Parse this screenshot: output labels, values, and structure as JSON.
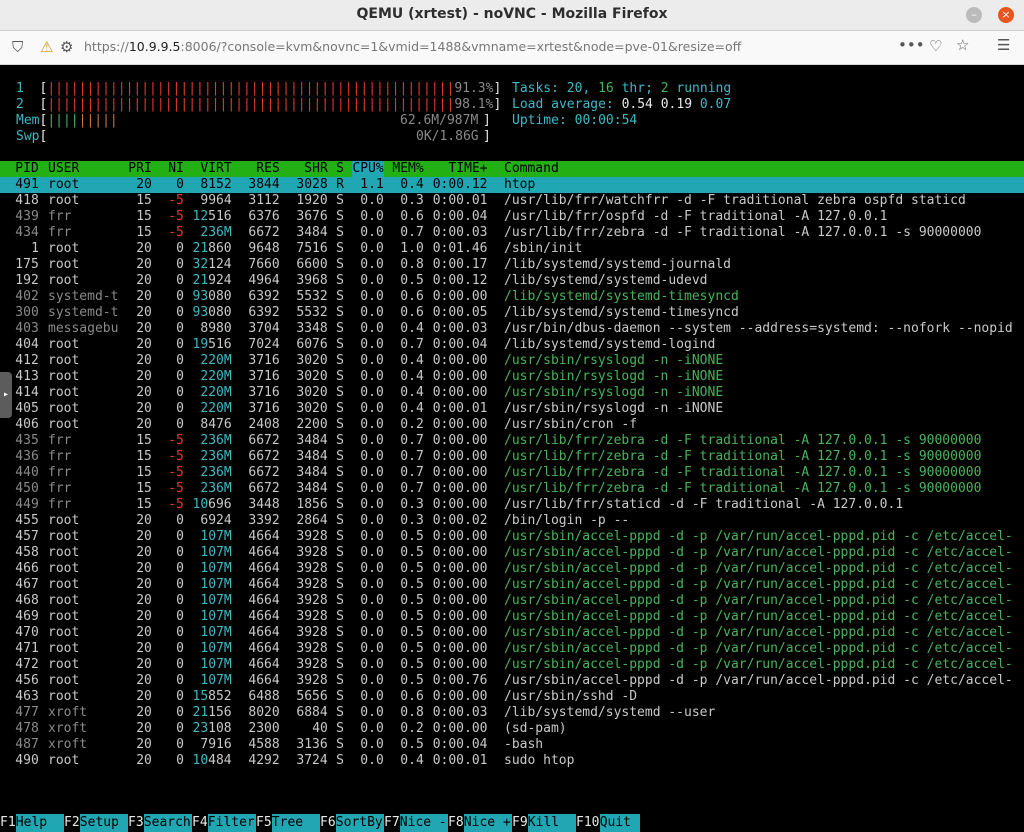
{
  "window": {
    "title": "QEMU (xrtest) - noVNC - Mozilla Firefox"
  },
  "browser": {
    "url_prefix": "https://",
    "url_host": "10.9.9.5",
    "url_rest": ":8006/?console=kvm&novnc=1&vmid=1488&vmname=xrtest&node=pve-01&resize=off"
  },
  "htop": {
    "cpu1": {
      "label": "1",
      "bar": "||||||||||||||||||||||||||||||||||||||||||||||||||||",
      "percent": "91.3%"
    },
    "cpu2": {
      "label": "2",
      "bar": "||||||||||||||||||||||||||||||||||||||||||||||||||||",
      "percent": "98.1%"
    },
    "mem": {
      "label": "Mem",
      "bar_green": "||||",
      "bar_orange": "|||||",
      "value": "62.6M/987M"
    },
    "swp": {
      "label": "Swp",
      "value": "0K/1.86G"
    },
    "tasks": {
      "label": "Tasks:",
      "tasks": "20,",
      "thr": "16",
      "thr_label": "thr;",
      "running": "2",
      "running_label": "running"
    },
    "load": {
      "label": "Load average:",
      "l1": "0.54",
      "l5": "0.19",
      "l15": "0.07"
    },
    "uptime": {
      "label": "Uptime:",
      "value": "00:00:54"
    },
    "columns": [
      "PID",
      "USER",
      "PRI",
      "NI",
      "VIRT",
      "RES",
      "SHR",
      "S",
      "CPU%",
      "MEM%",
      "TIME+",
      "Command"
    ],
    "processes": [
      {
        "pid": "491",
        "user": "root",
        "pri": "20",
        "ni": "0",
        "virt": "8152",
        "res": "3844",
        "shr": "3028",
        "s": "R",
        "cpu": "1.1",
        "mem": "0.4",
        "time": "0:00.12",
        "cmd": "htop",
        "sel": true
      },
      {
        "pid": "418",
        "user": "root",
        "pri": "15",
        "ni": "-5",
        "virt": "9964",
        "res": "3112",
        "shr": "1920",
        "s": "S",
        "cpu": "0.0",
        "mem": "0.3",
        "time": "0:00.01",
        "cmd": "/usr/lib/frr/watchfrr -d -F traditional zebra ospfd staticd"
      },
      {
        "pid": "439",
        "user": "frr",
        "pri": "15",
        "ni": "-5",
        "virt": "12516",
        "res": "6376",
        "shr": "3676",
        "s": "S",
        "cpu": "0.0",
        "mem": "0.6",
        "time": "0:00.04",
        "cmd": "/usr/lib/frr/ospfd -d -F traditional -A 127.0.0.1"
      },
      {
        "pid": "434",
        "user": "frr",
        "pri": "15",
        "ni": "-5",
        "virt": "236M",
        "res": "6672",
        "shr": "3484",
        "s": "S",
        "cpu": "0.0",
        "mem": "0.7",
        "time": "0:00.03",
        "cmd": "/usr/lib/frr/zebra -d -F traditional -A 127.0.0.1 -s 90000000"
      },
      {
        "pid": "1",
        "user": "root",
        "pri": "20",
        "ni": "0",
        "virt": "21860",
        "res": "9648",
        "shr": "7516",
        "s": "S",
        "cpu": "0.0",
        "mem": "1.0",
        "time": "0:01.46",
        "cmd": "/sbin/init"
      },
      {
        "pid": "175",
        "user": "root",
        "pri": "20",
        "ni": "0",
        "virt": "32124",
        "res": "7660",
        "shr": "6600",
        "s": "S",
        "cpu": "0.0",
        "mem": "0.8",
        "time": "0:00.17",
        "cmd": "/lib/systemd/systemd-journald"
      },
      {
        "pid": "192",
        "user": "root",
        "pri": "20",
        "ni": "0",
        "virt": "21924",
        "res": "4964",
        "shr": "3968",
        "s": "S",
        "cpu": "0.0",
        "mem": "0.5",
        "time": "0:00.12",
        "cmd": "/lib/systemd/systemd-udevd"
      },
      {
        "pid": "402",
        "user": "systemd-t",
        "pri": "20",
        "ni": "0",
        "virt": "93080",
        "res": "6392",
        "shr": "5532",
        "s": "S",
        "cpu": "0.0",
        "mem": "0.6",
        "time": "0:00.00",
        "cmd": "/lib/systemd/systemd-timesyncd",
        "thread": true
      },
      {
        "pid": "300",
        "user": "systemd-t",
        "pri": "20",
        "ni": "0",
        "virt": "93080",
        "res": "6392",
        "shr": "5532",
        "s": "S",
        "cpu": "0.0",
        "mem": "0.6",
        "time": "0:00.05",
        "cmd": "/lib/systemd/systemd-timesyncd"
      },
      {
        "pid": "403",
        "user": "messagebu",
        "pri": "20",
        "ni": "0",
        "virt": "8980",
        "res": "3704",
        "shr": "3348",
        "s": "S",
        "cpu": "0.0",
        "mem": "0.4",
        "time": "0:00.03",
        "cmd": "/usr/bin/dbus-daemon --system --address=systemd: --nofork --nopid"
      },
      {
        "pid": "404",
        "user": "root",
        "pri": "20",
        "ni": "0",
        "virt": "19516",
        "res": "7024",
        "shr": "6076",
        "s": "S",
        "cpu": "0.0",
        "mem": "0.7",
        "time": "0:00.04",
        "cmd": "/lib/systemd/systemd-logind"
      },
      {
        "pid": "412",
        "user": "root",
        "pri": "20",
        "ni": "0",
        "virt": "220M",
        "res": "3716",
        "shr": "3020",
        "s": "S",
        "cpu": "0.0",
        "mem": "0.4",
        "time": "0:00.00",
        "cmd": "/usr/sbin/rsyslogd -n -iNONE",
        "thread": true
      },
      {
        "pid": "413",
        "user": "root",
        "pri": "20",
        "ni": "0",
        "virt": "220M",
        "res": "3716",
        "shr": "3020",
        "s": "S",
        "cpu": "0.0",
        "mem": "0.4",
        "time": "0:00.00",
        "cmd": "/usr/sbin/rsyslogd -n -iNONE",
        "thread": true
      },
      {
        "pid": "414",
        "user": "root",
        "pri": "20",
        "ni": "0",
        "virt": "220M",
        "res": "3716",
        "shr": "3020",
        "s": "S",
        "cpu": "0.0",
        "mem": "0.4",
        "time": "0:00.00",
        "cmd": "/usr/sbin/rsyslogd -n -iNONE",
        "thread": true
      },
      {
        "pid": "405",
        "user": "root",
        "pri": "20",
        "ni": "0",
        "virt": "220M",
        "res": "3716",
        "shr": "3020",
        "s": "S",
        "cpu": "0.0",
        "mem": "0.4",
        "time": "0:00.01",
        "cmd": "/usr/sbin/rsyslogd -n -iNONE"
      },
      {
        "pid": "406",
        "user": "root",
        "pri": "20",
        "ni": "0",
        "virt": "8476",
        "res": "2408",
        "shr": "2200",
        "s": "S",
        "cpu": "0.0",
        "mem": "0.2",
        "time": "0:00.00",
        "cmd": "/usr/sbin/cron -f"
      },
      {
        "pid": "435",
        "user": "frr",
        "pri": "15",
        "ni": "-5",
        "virt": "236M",
        "res": "6672",
        "shr": "3484",
        "s": "S",
        "cpu": "0.0",
        "mem": "0.7",
        "time": "0:00.00",
        "cmd": "/usr/lib/frr/zebra -d -F traditional -A 127.0.0.1 -s 90000000",
        "thread": true
      },
      {
        "pid": "436",
        "user": "frr",
        "pri": "15",
        "ni": "-5",
        "virt": "236M",
        "res": "6672",
        "shr": "3484",
        "s": "S",
        "cpu": "0.0",
        "mem": "0.7",
        "time": "0:00.00",
        "cmd": "/usr/lib/frr/zebra -d -F traditional -A 127.0.0.1 -s 90000000",
        "thread": true
      },
      {
        "pid": "440",
        "user": "frr",
        "pri": "15",
        "ni": "-5",
        "virt": "236M",
        "res": "6672",
        "shr": "3484",
        "s": "S",
        "cpu": "0.0",
        "mem": "0.7",
        "time": "0:00.00",
        "cmd": "/usr/lib/frr/zebra -d -F traditional -A 127.0.0.1 -s 90000000",
        "thread": true
      },
      {
        "pid": "450",
        "user": "frr",
        "pri": "15",
        "ni": "-5",
        "virt": "236M",
        "res": "6672",
        "shr": "3484",
        "s": "S",
        "cpu": "0.0",
        "mem": "0.7",
        "time": "0:00.00",
        "cmd": "/usr/lib/frr/zebra -d -F traditional -A 127.0.0.1 -s 90000000",
        "thread": true
      },
      {
        "pid": "449",
        "user": "frr",
        "pri": "15",
        "ni": "-5",
        "virt": "10696",
        "res": "3448",
        "shr": "1856",
        "s": "S",
        "cpu": "0.0",
        "mem": "0.3",
        "time": "0:00.00",
        "cmd": "/usr/lib/frr/staticd -d -F traditional -A 127.0.0.1"
      },
      {
        "pid": "455",
        "user": "root",
        "pri": "20",
        "ni": "0",
        "virt": "6924",
        "res": "3392",
        "shr": "2864",
        "s": "S",
        "cpu": "0.0",
        "mem": "0.3",
        "time": "0:00.02",
        "cmd": "/bin/login -p --"
      },
      {
        "pid": "457",
        "user": "root",
        "pri": "20",
        "ni": "0",
        "virt": "107M",
        "res": "4664",
        "shr": "3928",
        "s": "S",
        "cpu": "0.0",
        "mem": "0.5",
        "time": "0:00.00",
        "cmd": "/usr/sbin/accel-pppd -d -p /var/run/accel-pppd.pid -c /etc/accel-",
        "thread": true
      },
      {
        "pid": "458",
        "user": "root",
        "pri": "20",
        "ni": "0",
        "virt": "107M",
        "res": "4664",
        "shr": "3928",
        "s": "S",
        "cpu": "0.0",
        "mem": "0.5",
        "time": "0:00.00",
        "cmd": "/usr/sbin/accel-pppd -d -p /var/run/accel-pppd.pid -c /etc/accel-",
        "thread": true
      },
      {
        "pid": "466",
        "user": "root",
        "pri": "20",
        "ni": "0",
        "virt": "107M",
        "res": "4664",
        "shr": "3928",
        "s": "S",
        "cpu": "0.0",
        "mem": "0.5",
        "time": "0:00.00",
        "cmd": "/usr/sbin/accel-pppd -d -p /var/run/accel-pppd.pid -c /etc/accel-",
        "thread": true
      },
      {
        "pid": "467",
        "user": "root",
        "pri": "20",
        "ni": "0",
        "virt": "107M",
        "res": "4664",
        "shr": "3928",
        "s": "S",
        "cpu": "0.0",
        "mem": "0.5",
        "time": "0:00.00",
        "cmd": "/usr/sbin/accel-pppd -d -p /var/run/accel-pppd.pid -c /etc/accel-",
        "thread": true
      },
      {
        "pid": "468",
        "user": "root",
        "pri": "20",
        "ni": "0",
        "virt": "107M",
        "res": "4664",
        "shr": "3928",
        "s": "S",
        "cpu": "0.0",
        "mem": "0.5",
        "time": "0:00.00",
        "cmd": "/usr/sbin/accel-pppd -d -p /var/run/accel-pppd.pid -c /etc/accel-",
        "thread": true
      },
      {
        "pid": "469",
        "user": "root",
        "pri": "20",
        "ni": "0",
        "virt": "107M",
        "res": "4664",
        "shr": "3928",
        "s": "S",
        "cpu": "0.0",
        "mem": "0.5",
        "time": "0:00.00",
        "cmd": "/usr/sbin/accel-pppd -d -p /var/run/accel-pppd.pid -c /etc/accel-",
        "thread": true
      },
      {
        "pid": "470",
        "user": "root",
        "pri": "20",
        "ni": "0",
        "virt": "107M",
        "res": "4664",
        "shr": "3928",
        "s": "S",
        "cpu": "0.0",
        "mem": "0.5",
        "time": "0:00.00",
        "cmd": "/usr/sbin/accel-pppd -d -p /var/run/accel-pppd.pid -c /etc/accel-",
        "thread": true
      },
      {
        "pid": "471",
        "user": "root",
        "pri": "20",
        "ni": "0",
        "virt": "107M",
        "res": "4664",
        "shr": "3928",
        "s": "S",
        "cpu": "0.0",
        "mem": "0.5",
        "time": "0:00.00",
        "cmd": "/usr/sbin/accel-pppd -d -p /var/run/accel-pppd.pid -c /etc/accel-",
        "thread": true
      },
      {
        "pid": "472",
        "user": "root",
        "pri": "20",
        "ni": "0",
        "virt": "107M",
        "res": "4664",
        "shr": "3928",
        "s": "S",
        "cpu": "0.0",
        "mem": "0.5",
        "time": "0:00.00",
        "cmd": "/usr/sbin/accel-pppd -d -p /var/run/accel-pppd.pid -c /etc/accel-",
        "thread": true
      },
      {
        "pid": "456",
        "user": "root",
        "pri": "20",
        "ni": "0",
        "virt": "107M",
        "res": "4664",
        "shr": "3928",
        "s": "S",
        "cpu": "0.0",
        "mem": "0.5",
        "time": "0:00.76",
        "cmd": "/usr/sbin/accel-pppd -d -p /var/run/accel-pppd.pid -c /etc/accel-"
      },
      {
        "pid": "463",
        "user": "root",
        "pri": "20",
        "ni": "0",
        "virt": "15852",
        "res": "6488",
        "shr": "5656",
        "s": "S",
        "cpu": "0.0",
        "mem": "0.6",
        "time": "0:00.00",
        "cmd": "/usr/sbin/sshd -D"
      },
      {
        "pid": "477",
        "user": "xroft",
        "pri": "20",
        "ni": "0",
        "virt": "21156",
        "res": "8020",
        "shr": "6884",
        "s": "S",
        "cpu": "0.0",
        "mem": "0.8",
        "time": "0:00.03",
        "cmd": "/lib/systemd/systemd --user"
      },
      {
        "pid": "478",
        "user": "xroft",
        "pri": "20",
        "ni": "0",
        "virt": "23108",
        "res": "2300",
        "shr": "40",
        "s": "S",
        "cpu": "0.0",
        "mem": "0.2",
        "time": "0:00.00",
        "cmd": "(sd-pam)"
      },
      {
        "pid": "487",
        "user": "xroft",
        "pri": "20",
        "ni": "0",
        "virt": "7916",
        "res": "4588",
        "shr": "3136",
        "s": "S",
        "cpu": "0.0",
        "mem": "0.5",
        "time": "0:00.04",
        "cmd": "-bash"
      },
      {
        "pid": "490",
        "user": "root",
        "pri": "20",
        "ni": "0",
        "virt": "10484",
        "res": "4292",
        "shr": "3724",
        "s": "S",
        "cpu": "0.0",
        "mem": "0.4",
        "time": "0:00.01",
        "cmd": "sudo htop"
      }
    ],
    "fkeys": [
      {
        "key": "F1",
        "label": "Help  "
      },
      {
        "key": "F2",
        "label": "Setup "
      },
      {
        "key": "F3",
        "label": "Search"
      },
      {
        "key": "F4",
        "label": "Filter"
      },
      {
        "key": "F5",
        "label": "Tree  "
      },
      {
        "key": "F6",
        "label": "SortBy"
      },
      {
        "key": "F7",
        "label": "Nice -"
      },
      {
        "key": "F8",
        "label": "Nice +"
      },
      {
        "key": "F9",
        "label": "Kill  "
      },
      {
        "key": "F10",
        "label": "Quit  "
      }
    ]
  }
}
